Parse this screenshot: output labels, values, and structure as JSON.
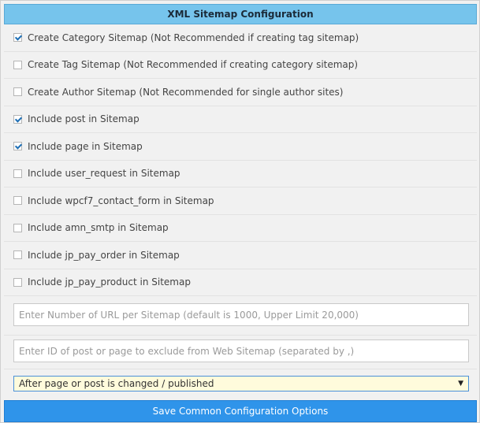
{
  "header": {
    "title": "XML Sitemap Configuration"
  },
  "options": [
    {
      "label": "Create Category Sitemap (Not Recommended if creating tag sitemap)",
      "checked": true
    },
    {
      "label": "Create Tag Sitemap (Not Recommended if creating category sitemap)",
      "checked": false
    },
    {
      "label": "Create Author Sitemap (Not Recommended for single author sites)",
      "checked": false
    },
    {
      "label": "Include post in Sitemap",
      "checked": true
    },
    {
      "label": "Include page in Sitemap",
      "checked": true
    },
    {
      "label": "Include user_request in Sitemap",
      "checked": false
    },
    {
      "label": "Include wpcf7_contact_form in Sitemap",
      "checked": false
    },
    {
      "label": "Include amn_smtp in Sitemap",
      "checked": false
    },
    {
      "label": "Include jp_pay_order in Sitemap",
      "checked": false
    },
    {
      "label": "Include jp_pay_product in Sitemap",
      "checked": false
    }
  ],
  "url_limit_input": {
    "placeholder": "Enter Number of URL per Sitemap (default is 1000, Upper Limit 20,000)",
    "value": ""
  },
  "exclude_input": {
    "placeholder": "Enter ID of post or page to exclude from Web Sitemap (separated by ,)",
    "value": ""
  },
  "update_select": {
    "selected": "After page or post is changed / published"
  },
  "save_button": {
    "label": "Save Common Configuration Options"
  },
  "colors": {
    "header_bg": "#76c4ec",
    "button_bg": "#2f94ea",
    "select_bg": "#fffbdc",
    "checkmark": "#1e6fb5"
  }
}
